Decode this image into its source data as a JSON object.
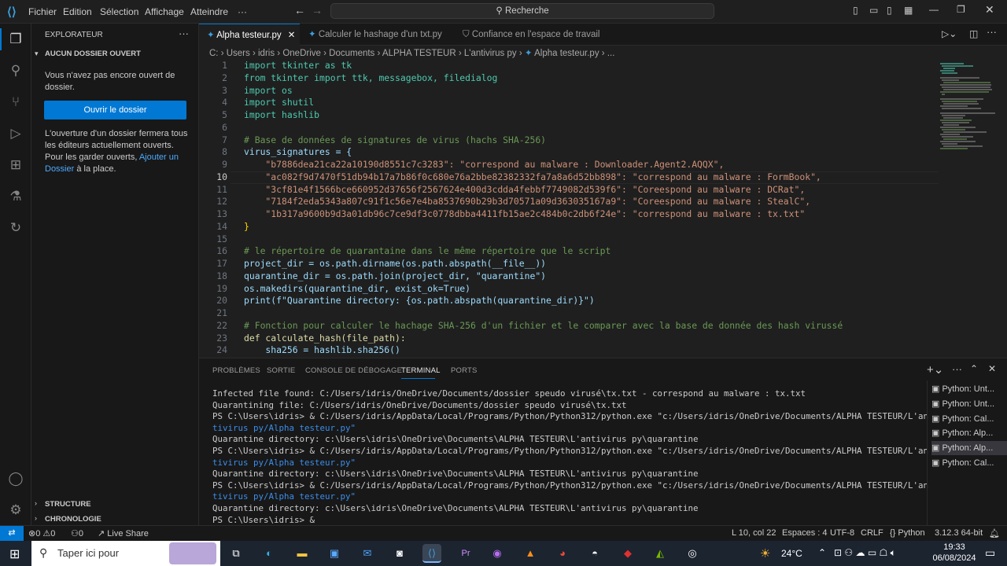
{
  "titlebar": {
    "menus": [
      "Fichier",
      "Edition",
      "Sélection",
      "Affichage",
      "Atteindre",
      "···"
    ],
    "search": "Recherche"
  },
  "sidebar": {
    "title": "EXPLORATEUR",
    "section": "AUCUN DOSSIER OUVERT",
    "msg1": "Vous n'avez pas encore ouvert de dossier.",
    "open_button": "Ouvrir le dossier",
    "msg2a": "L'ouverture d'un dossier fermera tous les éditeurs actuellement ouverts. Pour les garder ouverts,",
    "msg2link": "Ajouter un Dossier",
    "msg2b": " à la place.",
    "structure": "STRUCTURE",
    "chronologie": "CHRONOLOGIE"
  },
  "tabs": [
    {
      "label": "Alpha testeur.py"
    },
    {
      "label": "Calculer le hashage d'un txt.py"
    },
    {
      "label": "Confiance en l'espace de travail"
    }
  ],
  "breadcrumb": [
    "C:",
    "Users",
    "idris",
    "OneDrive",
    "Documents",
    "ALPHA TESTEUR",
    "L'antivirus py",
    "Alpha testeur.py",
    "..."
  ],
  "code_lines": [
    "1",
    "2",
    "3",
    "4",
    "5",
    "6",
    "7",
    "8",
    "9",
    "10",
    "11",
    "12",
    "13",
    "14",
    "15",
    "16",
    "17",
    "18",
    "19",
    "20",
    "21",
    "22",
    "23",
    "24"
  ],
  "code": {
    "l1": "import tkinter as tk",
    "l2": "from tkinter import ttk, messagebox, filedialog",
    "l3": "import os",
    "l4": "import shutil",
    "l5": "import hashlib",
    "l7": "# Base de données de signatures de virus (hachs SHA-256)",
    "l8": "virus_signatures = {",
    "l9": "    \"b7886dea21ca22a10190d8551c7c3283\": \"correspond au malware : Downloader.Agent2.AQQX\",",
    "l10": "    \"ac082f9d7470f51db94b17a7b86f0c680e76a2bbe82382332fa7a8a6d52bb898\": \"correspond au malware : FormBook\",",
    "l11": "    \"3cf81e4f1566bce660952d37656f2567624e400d3cdda4febbf7749082d539f6\": \"Coreespond au malware : DCRat\",",
    "l12": "    \"7184f2eda5343a807c91f1c56e7e4ba8537690b29b3d70571a09d363035167a9\": \"Coreespond au malware : StealC\",",
    "l13": "    \"1b317a9600b9d3a01db96c7ce9df3c0778dbba4411fb15ae2c484b0c2db6f24e\": \"correspond au malware : tx.txt\"",
    "l14": "}",
    "l16": "# le répertoire de quarantaine dans le même répertoire que le script",
    "l17": "project_dir = os.path.dirname(os.path.abspath(__file__))",
    "l18": "quarantine_dir = os.path.join(project_dir, \"quarantine\")",
    "l19": "os.makedirs(quarantine_dir, exist_ok=True)",
    "l20": "print(f\"Quarantine directory: {os.path.abspath(quarantine_dir)}\")",
    "l22": "# Fonction pour calculer le hachage SHA-256 d'un fichier et le comparer avec la base de donnée des hash virussé",
    "l23": "def calculate_hash(file_path):",
    "l24": "    sha256 = hashlib.sha256()"
  },
  "panel": {
    "tabs": [
      "PROBLÈMES",
      "SORTIE",
      "CONSOLE DE DÉBOGAGE",
      "TERMINAL",
      "PORTS"
    ],
    "active": "TERMINAL"
  },
  "terminal": [
    "Infected file found: C:/Users/idris/OneDrive/Documents/dossier speudo virusé\\tx.txt - correspond au malware : tx.txt",
    "Quarantining file: C:/Users/idris/OneDrive/Documents/dossier speudo virusé\\tx.txt",
    "PS C:\\Users\\idris> & C:/Users/idris/AppData/Local/Programs/Python/Python312/python.exe \"c:/Users/idris/OneDrive/Documents/ALPHA TESTEUR/L'an",
    "tivirus py/Alpha testeur.py\"",
    "Quarantine directory: c:\\Users\\idris\\OneDrive\\Documents\\ALPHA TESTEUR\\L'antivirus py\\quarantine",
    "PS C:\\Users\\idris> & C:/Users/idris/AppData/Local/Programs/Python/Python312/python.exe \"c:/Users/idris/OneDrive/Documents/ALPHA TESTEUR/L'an",
    "tivirus py/Alpha testeur.py\"",
    "Quarantine directory: c:\\Users\\idris\\OneDrive\\Documents\\ALPHA TESTEUR\\L'antivirus py\\quarantine",
    "PS C:\\Users\\idris> & C:/Users/idris/AppData/Local/Programs/Python/Python312/python.exe \"c:/Users/idris/OneDrive/Documents/ALPHA TESTEUR/L'an",
    "tivirus py/Alpha testeur.py\"",
    "Quarantine directory: c:\\Users\\idris\\OneDrive\\Documents\\ALPHA TESTEUR\\L'antivirus py\\quarantine",
    "PS C:\\Users\\idris> &"
  ],
  "terminal_list": [
    "Python: Unt...",
    "Python: Unt...",
    "Python: Cal...",
    "Python: Alp...",
    "Python: Alp...",
    "Python: Cal..."
  ],
  "status": {
    "remote": "",
    "errors": "0",
    "warnings": "0",
    "ports": "0",
    "liveshare": "Live Share",
    "position": "L 10, col 22",
    "spaces": "Espaces : 4",
    "encoding": "UTF-8",
    "eol": "CRLF",
    "language": "Python",
    "interpreter": "3.12.3 64-bit"
  },
  "taskbar": {
    "search": "Taper ici pour",
    "weather": "24°C",
    "time": "19:33",
    "date": "06/08/2024"
  }
}
